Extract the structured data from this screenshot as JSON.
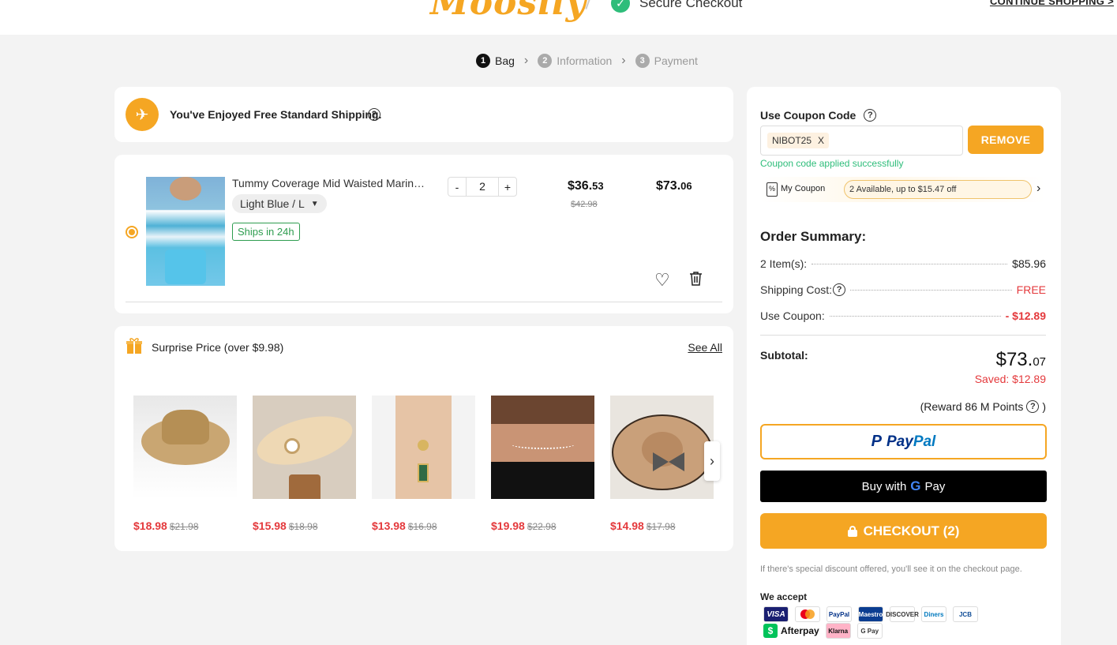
{
  "header": {
    "logo_text": "Mooslly",
    "secure_checkout": "Secure Checkout",
    "continue_shopping": "CONTINUE SHOPPING >"
  },
  "steps": [
    {
      "num": "1",
      "label": "Bag"
    },
    {
      "num": "2",
      "label": "Information"
    },
    {
      "num": "3",
      "label": "Payment"
    }
  ],
  "shipping_notice": {
    "text": "You've Enjoyed Free Standard Shipping.",
    "help": "?"
  },
  "cart_item": {
    "title": "Tummy Coverage Mid Waisted Marine Print Tankini Swimsuit",
    "variant": "Light Blue / L",
    "ships_tag": "Ships in 24h",
    "qty_minus": "-",
    "qty": "2",
    "qty_plus": "+",
    "unit_price_main": "$36.",
    "unit_price_cents": "53",
    "unit_price_old": "$42.98",
    "total_main": "$73.",
    "total_cents": "06",
    "heart_glyph": "♡"
  },
  "surprise": {
    "title": "Surprise Price (over $9.98)",
    "see_all": "See All",
    "next_glyph": "›",
    "products": [
      {
        "price": "$18.98",
        "old_price": "$21.98"
      },
      {
        "price": "$15.98",
        "old_price": "$18.98"
      },
      {
        "price": "$13.98",
        "old_price": "$16.98"
      },
      {
        "price": "$19.98",
        "old_price": "$22.98"
      },
      {
        "price": "$14.98",
        "old_price": "$17.98"
      }
    ]
  },
  "coupon": {
    "label": "Use Coupon Code",
    "help": "?",
    "code": "NIBOT25",
    "clear": "X",
    "remove_button": "REMOVE",
    "success_msg": "Coupon code applied successfully",
    "my_coupon_label": "My Coupon",
    "my_coupon_icon": "%",
    "my_coupon_info": "2 Available, up to $15.47 off",
    "arrow": "›"
  },
  "summary": {
    "title": "Order Summary:",
    "items_label": "2 Item(s):",
    "items_value": "$85.96",
    "shipping_label": "Shipping Cost:",
    "shipping_help": "?",
    "shipping_value": "FREE",
    "coupon_label": "Use Coupon:",
    "coupon_value": "- $12.89",
    "subtotal_label": "Subtotal:",
    "subtotal_main": "$73.",
    "subtotal_cents": "07",
    "saved": "Saved: $12.89",
    "reward": "(Reward 86 M Points",
    "reward_help": "?",
    "reward_close": ")"
  },
  "buttons": {
    "paypal_p": "P",
    "paypal_pay": "Pay",
    "paypal_pal": "Pal",
    "gpay_prefix": "Buy with",
    "gpay_g": "G",
    "gpay_pay": "Pay",
    "checkout": "CHECKOUT (2)"
  },
  "footer": {
    "discount_note": "If there's special discount offered, you'll see it on the checkout page.",
    "we_accept": "We accept",
    "payment_methods_row1": [
      "VISA",
      "MC",
      "PayPal",
      "Maestro",
      "DISCOVER",
      "Diners",
      "JCB"
    ],
    "afterpay_icon": "$",
    "afterpay": "Afterpay",
    "klarna": "Klarna",
    "gpay_badge": "G Pay"
  },
  "colors": {
    "accent": "#f5a623",
    "sale_red": "#e4393c",
    "success_green": "#2ebd7a"
  }
}
